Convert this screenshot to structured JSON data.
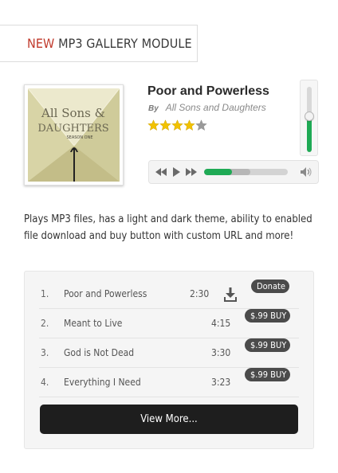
{
  "header": {
    "accent": "NEW",
    "title": "MP3 GALLERY MODULE"
  },
  "now_playing": {
    "title": "Poor and Powerless",
    "by_label": "By",
    "artist": "All Sons and Daughters",
    "rating": 4,
    "rating_max": 5,
    "progress_fraction": 0.33,
    "buffered_fraction": 0.55,
    "volume_fraction": 0.55
  },
  "album_art": {
    "line1": "All Sons &",
    "line2": "DAUGHTERS",
    "line3": "SEASON ONE"
  },
  "description": "Plays MP3 files, has a light and dark theme, ability to enabled file download and buy button with custom URL and more!",
  "playlist": {
    "tracks": [
      {
        "num": "1.",
        "title": "Poor and Powerless",
        "duration": "2:30",
        "action": "Donate",
        "download": true
      },
      {
        "num": "2.",
        "title": "Meant to Live",
        "duration": "4:15",
        "action": "$.99 BUY",
        "download": false
      },
      {
        "num": "3.",
        "title": "God is Not Dead",
        "duration": "3:30",
        "action": "$.99 BUY",
        "download": false
      },
      {
        "num": "4.",
        "title": "Everything I Need",
        "duration": "3:23",
        "action": "$.99 BUY",
        "download": false
      }
    ],
    "view_more": "View More..."
  },
  "colors": {
    "accent": "#c0392b",
    "progress": "#1faa55",
    "star": "#f2c200",
    "badge": "#4b4b4b",
    "button": "#1e1e1e"
  },
  "icons": [
    "rewind-icon",
    "play-icon",
    "fast-forward-icon",
    "volume-icon",
    "download-icon",
    "star-icon"
  ]
}
